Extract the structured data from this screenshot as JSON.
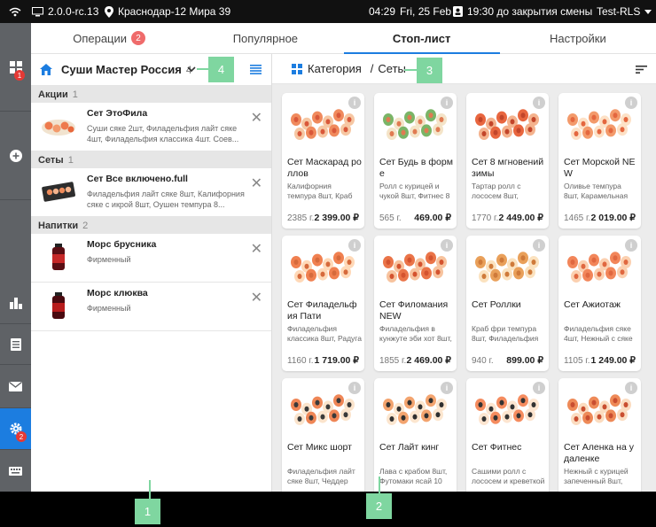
{
  "statusbar": {
    "version": "2.0.0-rc.13",
    "location": "Краснодар-12 Мира 39",
    "time": "04:29",
    "date": "Fri, 25 Feb",
    "shift": "19:30 до закрытия смены",
    "account": "Test-RLS"
  },
  "rail": {
    "badge_grid": "1",
    "badge_settings": "2"
  },
  "tabs": [
    {
      "label": "Операции",
      "badge": "2"
    },
    {
      "label": "Популярное"
    },
    {
      "label": "Стоп-лист"
    },
    {
      "label": "Настройки"
    }
  ],
  "left": {
    "title": "Суши Мастер Россия",
    "count": "4",
    "sections": [
      {
        "name": "Акции",
        "count": "1",
        "items": [
          {
            "name": "Сет ЭтоФила",
            "desc": "Суши сяке 2шт, Филадельфия лайт сяке 4шт, Филадельфия классика 4шт. Соев..."
          }
        ]
      },
      {
        "name": "Сеты",
        "count": "1",
        "items": [
          {
            "name": "Сет Все включено.full",
            "desc": "Филадельфия лайт сяке 8шт, Калифорния сяке с икрой 8шт, Оушен темпура 8..."
          }
        ]
      },
      {
        "name": "Напитки",
        "count": "2",
        "items": [
          {
            "name": "Морс брусника",
            "desc": "Фирменный"
          },
          {
            "name": "Морс клюква",
            "desc": "Фирменный"
          }
        ]
      }
    ]
  },
  "right": {
    "breadcrumb_category": "Категория",
    "breadcrumb_sep": "/",
    "breadcrumb_current": "Сеты",
    "cards": [
      {
        "name": "Сет Маскарад роллов",
        "desc": "Калифорния темпура 8шт, Краб фри",
        "weight": "2385 г.",
        "price": "2 399.00 ₽"
      },
      {
        "name": "Сет Будь в форме",
        "desc": "Ролл с курицей и чукой 8шт, Фитнес 8",
        "weight": "565 г.",
        "price": "469.00 ₽"
      },
      {
        "name": "Сет 8 мгновений зимы",
        "desc": "Тартар ролл с лососем 8шт, Манговы",
        "weight": "1770 г.",
        "price": "2 449.00 ₽"
      },
      {
        "name": "Сет Морской NEW",
        "desc": "Оливье темпура 8шт, Карамельная фила",
        "weight": "1465 г.",
        "price": "2 019.00 ₽"
      },
      {
        "name": "Сет Филадельфия Пати",
        "desc": "Филадельфия классика 8шт, Радуга",
        "weight": "1160 г.",
        "price": "1 719.00 ₽"
      },
      {
        "name": "Сет Филомания NEW",
        "desc": "Филадельфия в кунжуте эби хот 8шт,",
        "weight": "1855 г.",
        "price": "2 469.00 ₽"
      },
      {
        "name": "Сет Роллки",
        "desc": "Краб фри темпура 8шт, Филадельфия",
        "weight": "940 г.",
        "price": "899.00 ₽"
      },
      {
        "name": "Сет Ажиотаж",
        "desc": "Филадельфия сяке 4шт, Нежный с сяке",
        "weight": "1105 г.",
        "price": "1 249.00 ₽"
      },
      {
        "name": "Сет Микс шорт",
        "desc": "Филадельфия лайт сяке 8шт, Чеддер",
        "weight": "",
        "price": ""
      },
      {
        "name": "Сет Лайт кинг",
        "desc": "Лава с крабом 8шт, Футомаки ясай 10",
        "weight": "",
        "price": ""
      },
      {
        "name": "Сет Фитнес",
        "desc": "Сашими ролл с лососем и креветкой",
        "weight": "",
        "price": ""
      },
      {
        "name": "Сет Аленка на удаленке",
        "desc": "Нежный с курицей запеченный 8шт,",
        "weight": "",
        "price": ""
      }
    ]
  },
  "markers": [
    "1",
    "2",
    "3",
    "4"
  ],
  "colors": {
    "accent": "#1c7de0",
    "marker": "#7fd6a0",
    "badge": "#e53935"
  }
}
